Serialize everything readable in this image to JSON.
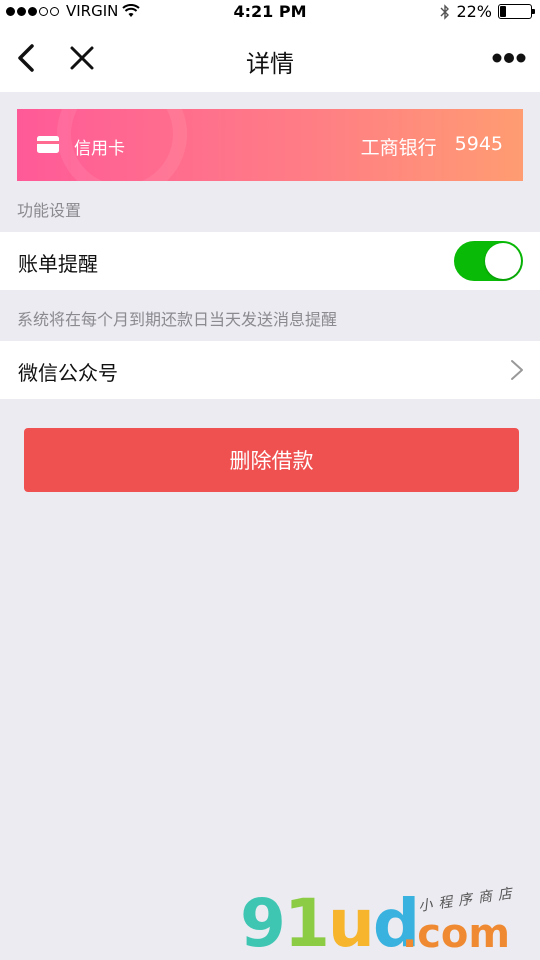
{
  "status_bar": {
    "carrier": "VIRGIN",
    "time": "4:21 PM",
    "battery": "22%",
    "battery_level": 0.22,
    "signal_bars_filled": 3,
    "signal_bars_total": 5
  },
  "nav": {
    "title": "详情",
    "icons": [
      "back-chevron-icon",
      "close-icon",
      "more-icon"
    ]
  },
  "card": {
    "type_label": "信用卡",
    "bank_name": "工商银行",
    "card_last_digits": "5945",
    "gradient": [
      "#ff5a98",
      "#ff9c71"
    ]
  },
  "settings": {
    "section_label": "功能设置",
    "bill_reminder_label": "账单提醒",
    "bill_reminder_on": true,
    "hint": "系统将在每个月到期还款日当天发送消息提醒",
    "wechat_label": "微信公众号"
  },
  "actions": {
    "delete_label": "删除借款",
    "delete_color": "#ef5150"
  },
  "watermark": {
    "logo_text": "91ud",
    "logo_suffix": ".com",
    "tagline": "小程序商店"
  },
  "colors": {
    "toggle_on": "#09bb07",
    "background": "#ebebf1"
  }
}
